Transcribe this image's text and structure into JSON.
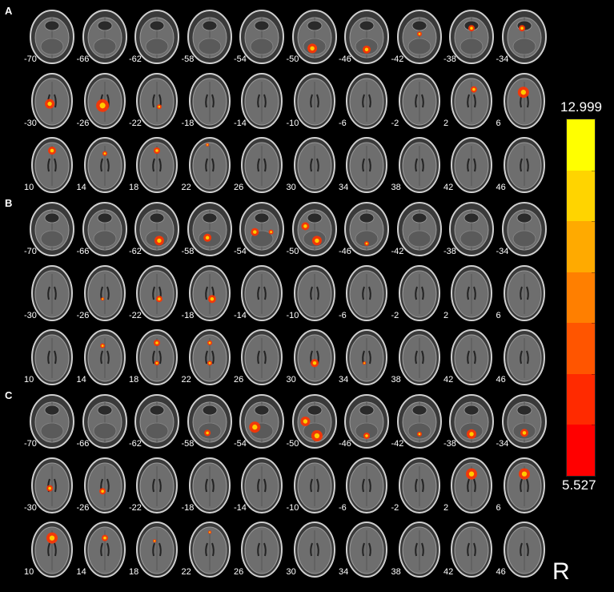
{
  "panels": [
    {
      "label": "A",
      "rows": [
        [
          "-70",
          "-66",
          "-62",
          "-58",
          "-54",
          "-50",
          "-46",
          "-42",
          "-38",
          "-34"
        ],
        [
          "-30",
          "-26",
          "-22",
          "-18",
          "-14",
          "-10",
          "-6",
          "-2",
          "2",
          "6"
        ],
        [
          "10",
          "14",
          "18",
          "22",
          "26",
          "30",
          "34",
          "38",
          "42",
          "46"
        ]
      ]
    },
    {
      "label": "B",
      "rows": [
        [
          "-70",
          "-66",
          "-62",
          "-58",
          "-54",
          "-50",
          "-46",
          "-42",
          "-38",
          "-34"
        ],
        [
          "-30",
          "-26",
          "-22",
          "-18",
          "-14",
          "-10",
          "-6",
          "-2",
          "2",
          "6"
        ],
        [
          "10",
          "14",
          "18",
          "22",
          "26",
          "30",
          "34",
          "38",
          "42",
          "46"
        ]
      ]
    },
    {
      "label": "C",
      "rows": [
        [
          "-70",
          "-66",
          "-62",
          "-58",
          "-54",
          "-50",
          "-46",
          "-42",
          "-38",
          "-34"
        ],
        [
          "-30",
          "-26",
          "-22",
          "-18",
          "-14",
          "-10",
          "-6",
          "-2",
          "2",
          "6"
        ],
        [
          "10",
          "14",
          "18",
          "22",
          "26",
          "30",
          "34",
          "38",
          "42",
          "46"
        ]
      ]
    }
  ],
  "colorbar": {
    "max_label": "12.999",
    "min_label": "5.527",
    "colors": [
      "#ffff00",
      "#ffd400",
      "#ffaa00",
      "#ff7f00",
      "#ff5500",
      "#ff2a00",
      "#ff0000"
    ]
  },
  "orientation_label": "R"
}
